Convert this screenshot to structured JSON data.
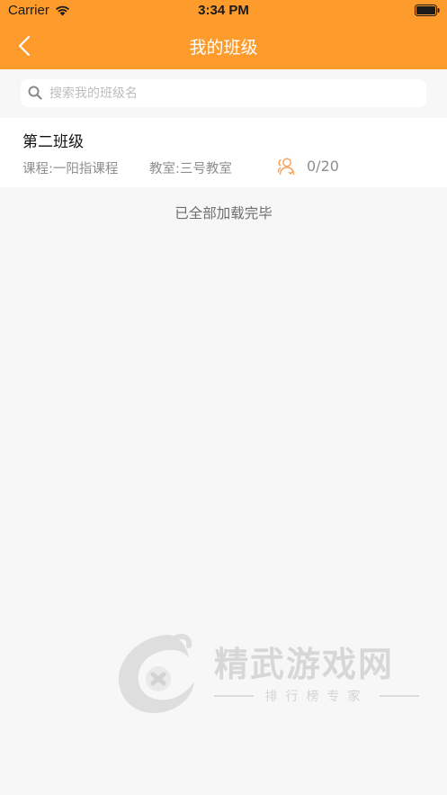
{
  "status_bar": {
    "carrier": "Carrier",
    "time": "3:34 PM",
    "wifi_icon": "wifi-icon",
    "battery_icon": "battery-icon"
  },
  "header": {
    "title": "我的班级",
    "back_icon": "chevron-left-icon",
    "background_color": "#fd9b2c"
  },
  "search": {
    "placeholder": "搜索我的班级名",
    "value": "",
    "icon": "search-icon"
  },
  "classes": [
    {
      "name": "第二班级",
      "course": "课程:一阳指课程",
      "classroom": "教室:三号教室",
      "students_icon": "students-icon",
      "enrollment": "0/20"
    }
  ],
  "list_footer": "已全部加载完毕",
  "watermark": {
    "title": "精武游戏网",
    "subtitle": "排行榜专家"
  }
}
